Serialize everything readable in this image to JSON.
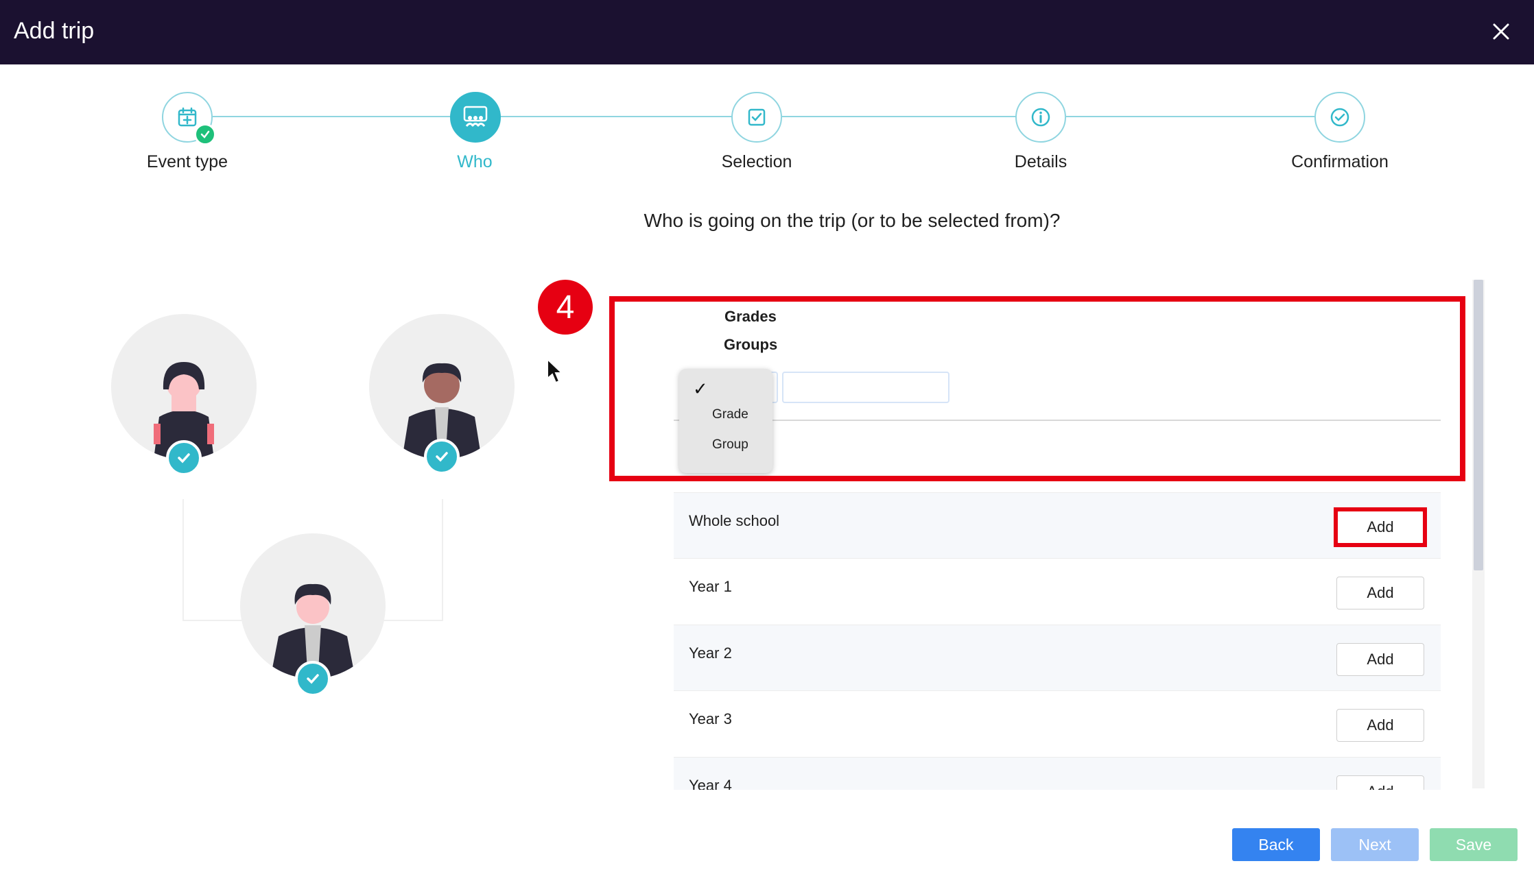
{
  "window": {
    "title": "Add trip"
  },
  "stepper": {
    "steps": [
      {
        "label": "Event type",
        "state": "complete",
        "icon": "calendar-plus-icon"
      },
      {
        "label": "Who",
        "state": "active",
        "icon": "group-icon"
      },
      {
        "label": "Selection",
        "state": "pending",
        "icon": "checkbox-icon"
      },
      {
        "label": "Details",
        "state": "pending",
        "icon": "info-icon"
      },
      {
        "label": "Confirmation",
        "state": "pending",
        "icon": "check-circle-icon"
      }
    ]
  },
  "question": "Who is going on the trip (or to be selected from)?",
  "annotation": {
    "number": "4"
  },
  "filter": {
    "grades_label": "Grades",
    "groups_label": "Groups",
    "dropdown_options": [
      "Grade",
      "Group"
    ],
    "search_value": ""
  },
  "list": {
    "rows": [
      {
        "label": "Whole school",
        "button": "Add"
      },
      {
        "label": "Year 1",
        "button": "Add"
      },
      {
        "label": "Year 2",
        "button": "Add"
      },
      {
        "label": "Year 3",
        "button": "Add"
      },
      {
        "label": "Year 4",
        "button": "Add"
      }
    ]
  },
  "footer": {
    "back": "Back",
    "next": "Next",
    "save": "Save"
  },
  "colors": {
    "header": "#1b1130",
    "accent": "#31b8ca",
    "complete": "#1ec07a",
    "annotation": "#e60012",
    "primary": "#3483f0"
  }
}
